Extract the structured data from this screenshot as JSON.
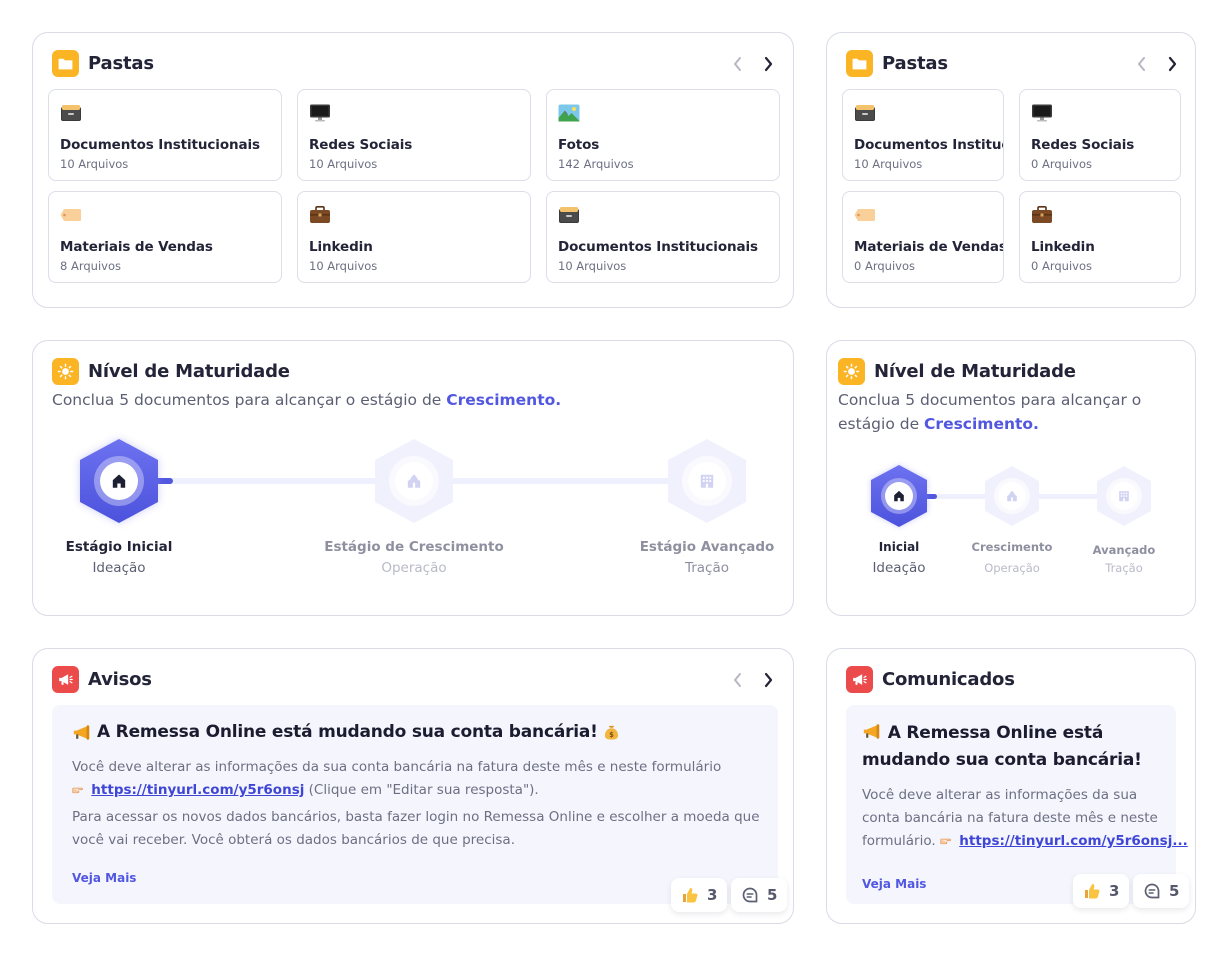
{
  "pastas_main": {
    "title": "Pastas",
    "folders": [
      {
        "name": "Documentos Institucionais",
        "count": "10 Arquivos",
        "icon": "file-cabinet-icon"
      },
      {
        "name": "Redes Sociais",
        "count": "10 Arquivos",
        "icon": "computer-monitor-icon"
      },
      {
        "name": "Fotos",
        "count": "142 Arquivos",
        "icon": "landscape-photo-icon"
      },
      {
        "name": "Materiais de Vendas",
        "count": "8 Arquivos",
        "icon": "tag-icon"
      },
      {
        "name": "Linkedin",
        "count": "10 Arquivos",
        "icon": "briefcase-icon"
      },
      {
        "name": "Documentos Institucionais",
        "count": "10 Arquivos",
        "icon": "file-cabinet-icon"
      }
    ]
  },
  "pastas_side": {
    "title": "Pastas",
    "folders": [
      {
        "name": "Documentos Institucionais",
        "count": "10 Arquivos",
        "icon": "file-cabinet-icon"
      },
      {
        "name": "Redes Sociais",
        "count": "0 Arquivos",
        "icon": "computer-monitor-icon"
      },
      {
        "name": "Materiais de Vendas",
        "count": "0 Arquivos",
        "icon": "tag-icon"
      },
      {
        "name": "Linkedin",
        "count": "0 Arquivos",
        "icon": "briefcase-icon"
      }
    ]
  },
  "maturidade_main": {
    "title": "Nível de Maturidade",
    "subtitle_prefix": "Conclua 5 documentos para alcançar o estágio de ",
    "subtitle_highlight": "Crescimento.",
    "progress": 0.15,
    "stages": [
      {
        "label": "Estágio Inicial",
        "sub": "Ideação",
        "active": true,
        "icon": "home-icon"
      },
      {
        "label": "Estágio de Crescimento",
        "sub": "Operação",
        "active": false,
        "icon": "temple-icon"
      },
      {
        "label": "Estágio Avançado",
        "sub": "Tração",
        "active": false,
        "icon": "building-icon"
      }
    ]
  },
  "maturidade_side": {
    "title": "Nível de Maturidade",
    "subtitle_line1": "Conclua 5 documentos para alcançar o",
    "subtitle_prefix2": "estágio de ",
    "subtitle_highlight": "Crescimento.",
    "stages": [
      {
        "label": "Inicial",
        "sub": "Ideação",
        "active": true
      },
      {
        "label": "Crescimento",
        "sub": "Operação",
        "active": false
      },
      {
        "label": "Avançado",
        "sub": "Tração",
        "active": false
      }
    ]
  },
  "avisos": {
    "title": "Avisos",
    "heading": "A Remessa Online está mudando sua conta bancária!",
    "line1": "Você deve alterar as informações da sua conta bancária na fatura deste mês e neste formulário",
    "link": "https://tinyurl.com/y5r6onsj",
    "link_suffix": " (Clique em \"Editar sua resposta\").",
    "line3": "Para acessar os novos dados bancários, basta fazer login no Remessa Online e escolher a moeda que",
    "line4": "você vai receber. Você obterá os dados bancários de que precisa.",
    "more": "Veja Mais",
    "likes": "3",
    "comments": "5"
  },
  "comunicados": {
    "title": "Comunicados",
    "heading1": "A Remessa Online está",
    "heading2": "mudando sua conta bancária!",
    "line1": "Você deve alterar as informações da sua",
    "line2": "conta bancária na fatura deste mês e neste",
    "line3_prefix": "formulário. ",
    "link": "https://tinyurl.com/y5r6onsj...",
    "more": "Veja Mais",
    "likes": "3",
    "comments": "5"
  },
  "colors": {
    "accent": "#5257e0",
    "yellow": "#fbb423",
    "red": "#eb4b4b",
    "border": "#d9dbe6",
    "notice_bg": "#f5f6fd"
  }
}
